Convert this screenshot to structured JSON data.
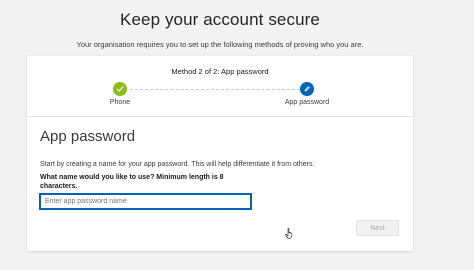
{
  "header": {
    "title": "Keep your account secure",
    "subtitle": "Your organisation requires you to set up the following methods of proving who you are."
  },
  "progress": {
    "method_title": "Method 2 of 2: App password",
    "steps": [
      {
        "label": "Phone",
        "state": "complete",
        "icon": "checkmark-icon",
        "color": "#8cbd18"
      },
      {
        "label": "App password",
        "state": "current",
        "icon": "pencil-icon",
        "color": "#0067b8"
      }
    ]
  },
  "form": {
    "section_title": "App password",
    "description": "Start by creating a name for your app password. This will help differentiate it from others.",
    "question": "What name would you like to use? Minimum length is 8 characters.",
    "input": {
      "value": "",
      "placeholder": "Enter app password name"
    },
    "next_label": "Next"
  },
  "colors": {
    "accent": "#0067b8",
    "success": "#8cbd18",
    "background": "#f3f3f3"
  }
}
